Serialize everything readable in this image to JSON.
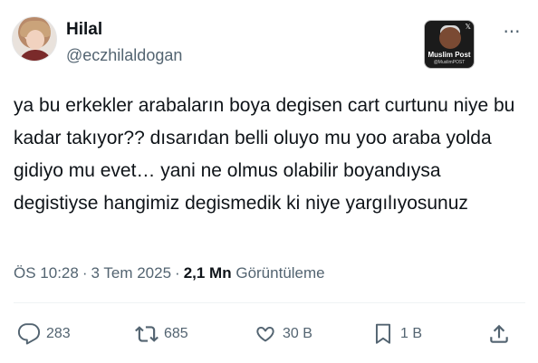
{
  "author": {
    "name": "Hilal",
    "handle": "@eczhilaldogan"
  },
  "badge": {
    "title": "Muslim Post",
    "subtitle": "@MuslimPOST"
  },
  "more_icon": "more-horizontal-icon",
  "tweet": {
    "text": "ya bu erkekler arabaların boya degisen cart curtunu niye bu kadar takıyor?? dısarıdan belli oluyo mu yoo araba yolda gidiyo mu evet… yani ne olmus olabilir boyandıysa degistiyse hangimiz degismedik ki niye yargılıyosunuz"
  },
  "meta": {
    "time": "ÖS 10:28",
    "date": "3 Tem 2025",
    "separator": "·",
    "views_count": "2,1 Mn",
    "views_label": "Görüntüleme"
  },
  "actions": {
    "reply": {
      "icon": "reply-icon",
      "count": "283"
    },
    "retweet": {
      "icon": "retweet-icon",
      "count": "685"
    },
    "like": {
      "icon": "heart-icon",
      "count": "30 B"
    },
    "bookmark": {
      "icon": "bookmark-icon",
      "count": "1 B"
    },
    "share": {
      "icon": "share-icon"
    }
  },
  "colors": {
    "text": "#0f1419",
    "secondary": "#536471",
    "divider": "#eff3f4",
    "background": "#ffffff"
  }
}
